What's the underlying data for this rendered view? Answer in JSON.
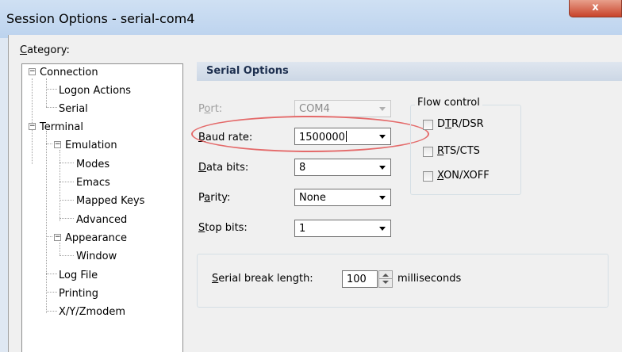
{
  "window": {
    "title": "Session Options - serial-com4",
    "close_glyph": "x"
  },
  "category": {
    "label_underlined": "C",
    "label_rest": "ategory:"
  },
  "tree": {
    "connection": "Connection",
    "logon_actions": "Logon Actions",
    "serial": "Serial",
    "terminal": "Terminal",
    "emulation": "Emulation",
    "modes": "Modes",
    "emacs": "Emacs",
    "mapped_keys": "Mapped Keys",
    "advanced": "Advanced",
    "appearance": "Appearance",
    "window": "Window",
    "log_file": "Log File",
    "printing": "Printing",
    "xyzmodem": "X/Y/Zmodem",
    "expand_glyph": "−"
  },
  "panel": {
    "header": "Serial Options",
    "port": {
      "label_a": "P",
      "label_u": "o",
      "label_b": "rt:",
      "value": "COM4"
    },
    "baud": {
      "label_u": "B",
      "label_b": "aud rate:",
      "value": "1500000"
    },
    "data_bits": {
      "label_u": "D",
      "label_b": "ata bits:",
      "value": "8"
    },
    "parity": {
      "label_a": "P",
      "label_u": "a",
      "label_b": "rity:",
      "value": "None"
    },
    "stop_bits": {
      "label_u": "S",
      "label_b": "top bits:",
      "value": "1"
    },
    "flow_control": {
      "title": "Flow control",
      "dtr_a": "D",
      "dtr_u": "T",
      "dtr_b": "R/DSR",
      "rts_u": "R",
      "rts_b": "TS/CTS",
      "xon_u": "X",
      "xon_b": "ON/XOFF"
    },
    "serial_break": {
      "label_u": "S",
      "label_b": "erial break length:",
      "value": "100",
      "unit": "milliseconds"
    }
  },
  "colors": {
    "title_bar": "#bcd3ee",
    "highlight": "#e46a6a",
    "panel_header_text": "#1e3050"
  }
}
